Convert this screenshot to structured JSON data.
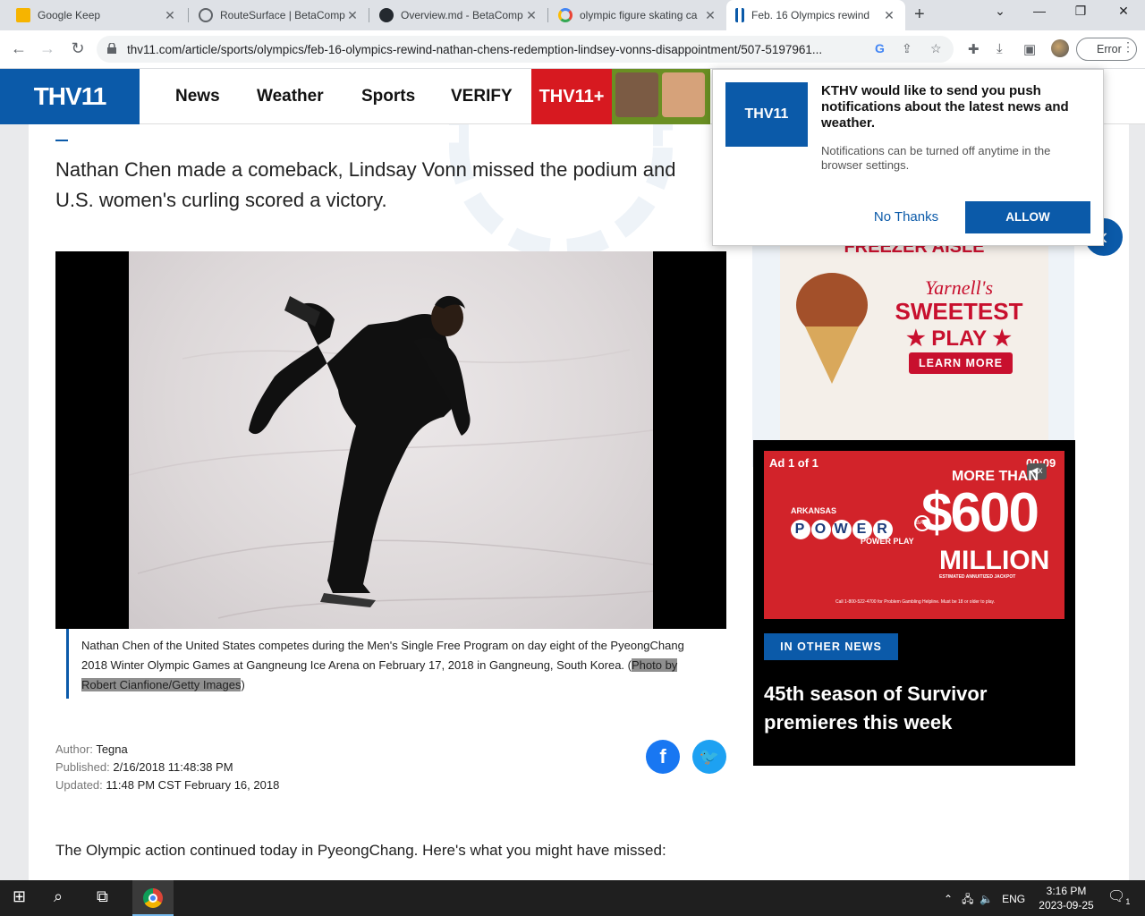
{
  "browser": {
    "tabs": [
      {
        "title": "Google Keep",
        "icon": "keep-icon"
      },
      {
        "title": "RouteSurface | BetaComp",
        "icon": "globe-icon"
      },
      {
        "title": "Overview.md - BetaComp",
        "icon": "github-icon"
      },
      {
        "title": "olympic figure skating ca",
        "icon": "google-icon"
      },
      {
        "title": "Feb. 16 Olympics rewind",
        "icon": "thv11-icon"
      }
    ],
    "url": "thv11.com/article/sports/olympics/feb-16-olympics-rewind-nathan-chens-redemption-lindsey-vonns-disappointment/507-5197961...",
    "error_label": "Error"
  },
  "site": {
    "logo_text": "THV11",
    "nav": [
      "News",
      "Weather",
      "Sports",
      "VERIFY"
    ],
    "plus_label": "THV11+"
  },
  "notification": {
    "logo_text": "THV11",
    "title": "KTHV would like to send you push notifications about the latest news and weather.",
    "subtitle": "Notifications can be turned off anytime in the browser settings.",
    "no_thanks": "No Thanks",
    "allow": "ALLOW"
  },
  "article": {
    "subhead": "Nathan Chen made a comeback, Lindsay Vonn missed the podium and\nU.S. women's curling scored a victory.",
    "caption": "Nathan Chen of the United States competes during the Men's Single Free Program on day eight of the PyeongChang 2018 Winter Olympic Games at Gangneung Ice Arena on February 17, 2018 in Gangneung, South Korea. (",
    "credit": "Photo by Robert Cianfione/Getty Images",
    "caption_end": ")",
    "author_label": "Author:",
    "author": "Tegna",
    "published_label": "Published:",
    "published": "2/16/2018 11:48:38 PM",
    "updated_label": "Updated:",
    "updated": "11:48 PM CST February 16, 2018",
    "intro": "The Olympic action continued today in PyeongChang. Here's what you might have missed:"
  },
  "ad1": {
    "top_text": "FREEZER AISLE",
    "brand": "Yarnell's",
    "line1": "SWEETEST",
    "line2": "★ PLAY ★",
    "cta": "LEARN MORE"
  },
  "video_ad": {
    "counter": "Ad 1 of 1",
    "time": "00:09",
    "state": "ARKANSAS",
    "game": "POWER",
    "ball": "BALL",
    "powerplay": "POWER PLAY",
    "more_than": "MORE THAN",
    "amount": "$600",
    "million": "MILLION",
    "estimated": "ESTIMATED ANNUITIZED JACKPOT",
    "fine_print": "Call 1-800-522-4700 for Problem Gambling Helpline. Must be 18 or older to play."
  },
  "other_news": {
    "label": "IN OTHER NEWS",
    "headline": "45th season of Survivor premieres this week"
  },
  "taskbar": {
    "lang": "ENG",
    "time": "3:16 PM",
    "date": "2023-09-25",
    "notifications": "1"
  }
}
